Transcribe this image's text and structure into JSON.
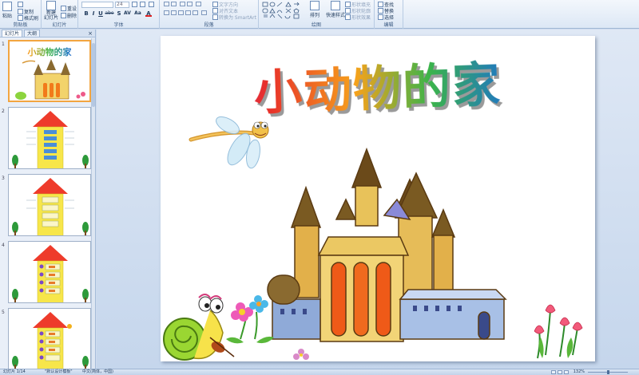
{
  "ribbon": {
    "clipboard": {
      "label": "剪贴板",
      "paste": "粘贴",
      "copy": "复制",
      "format_painter": "格式刷"
    },
    "slides": {
      "label": "幻灯片",
      "new_slide": "新建\n幻灯片",
      "reset": "重设",
      "delete": "删除"
    },
    "font": {
      "label": "字体",
      "font_size": "24",
      "bold": "B",
      "italic": "I",
      "underline": "U",
      "strike": "abe",
      "shadow": "S",
      "spacing": "AV",
      "case": "Aa",
      "color": "A"
    },
    "paragraph": {
      "label": "段落",
      "text_direction": "文字方向",
      "align_text": "对齐文本",
      "smartart": "转换为 SmartArt"
    },
    "drawing": {
      "label": "绘图",
      "arrange": "排列",
      "quick_styles": "快速样式",
      "shape_fill": "形状填充",
      "shape_outline": "形状轮廓",
      "shape_effects": "形状效果"
    },
    "editing": {
      "label": "编辑",
      "find": "查找",
      "replace": "替换",
      "select": "选择"
    }
  },
  "panel": {
    "tabs": [
      "幻灯片",
      "大纲"
    ],
    "close": "×",
    "thumb_numbers": [
      "1",
      "2",
      "3",
      "4",
      "5"
    ]
  },
  "slide": {
    "title": "小动物的家",
    "thumb_title": "小动物的家"
  },
  "status": {
    "slide_info": "幻灯片 1/14",
    "theme": "\"默认设计模板\"",
    "language": "中文(简体，中国)",
    "zoom": "132%"
  },
  "colors": {
    "ribbon_bg": "#dce7f5",
    "workspace_bg": "#c5d6ec",
    "selected_thumb_border": "#f3a540",
    "house_roof": "#ee3b2b",
    "house_body": "#f7e64a",
    "house_window": "#4a8ed8"
  }
}
